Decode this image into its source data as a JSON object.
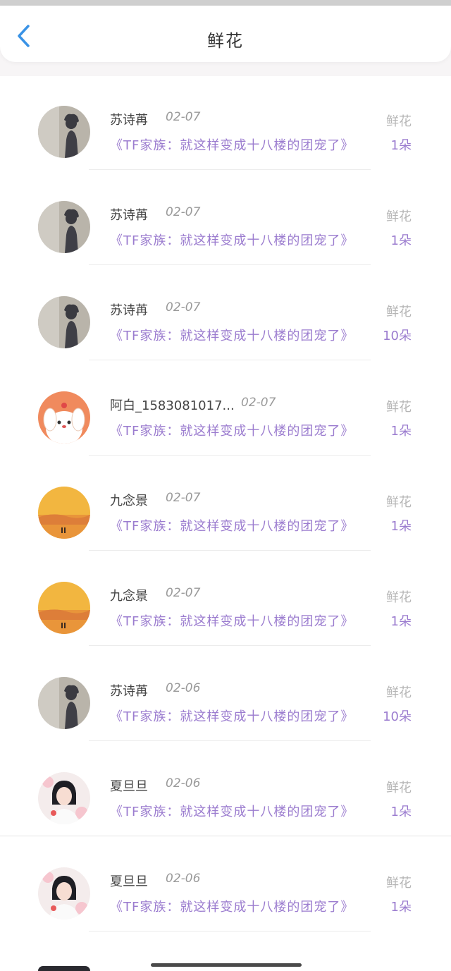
{
  "header": {
    "title": "鲜花",
    "back_icon": "chevron-left-icon"
  },
  "colors": {
    "accent": "#9b7ccf",
    "back": "#3a93e6"
  },
  "gifts": [
    {
      "user": "苏诗苒",
      "date": "02-07",
      "work": "《TF家族：就这样变成十八楼的团宠了》",
      "type": "鲜花",
      "count": "1朵",
      "avatar": "silhouette"
    },
    {
      "user": "苏诗苒",
      "date": "02-07",
      "work": "《TF家族：就这样变成十八楼的团宠了》",
      "type": "鲜花",
      "count": "1朵",
      "avatar": "silhouette"
    },
    {
      "user": "苏诗苒",
      "date": "02-07",
      "work": "《TF家族：就这样变成十八楼的团宠了》",
      "type": "鲜花",
      "count": "10朵",
      "avatar": "silhouette"
    },
    {
      "user": "阿白_1583081017...",
      "date": "02-07",
      "work": "《TF家族：就这样变成十八楼的团宠了》",
      "type": "鲜花",
      "count": "1朵",
      "avatar": "cartoon-dog"
    },
    {
      "user": "九念景",
      "date": "02-07",
      "work": "《TF家族：就这样变成十八楼的团宠了》",
      "type": "鲜花",
      "count": "1朵",
      "avatar": "sunset"
    },
    {
      "user": "九念景",
      "date": "02-07",
      "work": "《TF家族：就这样变成十八楼的团宠了》",
      "type": "鲜花",
      "count": "1朵",
      "avatar": "sunset"
    },
    {
      "user": "苏诗苒",
      "date": "02-06",
      "work": "《TF家族：就这样变成十八楼的团宠了》",
      "type": "鲜花",
      "count": "10朵",
      "avatar": "silhouette"
    },
    {
      "user": "夏旦旦",
      "date": "02-06",
      "work": "《TF家族：就这样变成十八楼的团宠了》",
      "type": "鲜花",
      "count": "1朵",
      "avatar": "girl-photo"
    },
    {
      "user": "夏旦旦",
      "date": "02-06",
      "work": "《TF家族：就这样变成十八楼的团宠了》",
      "type": "鲜花",
      "count": "1朵",
      "avatar": "girl-photo"
    }
  ]
}
